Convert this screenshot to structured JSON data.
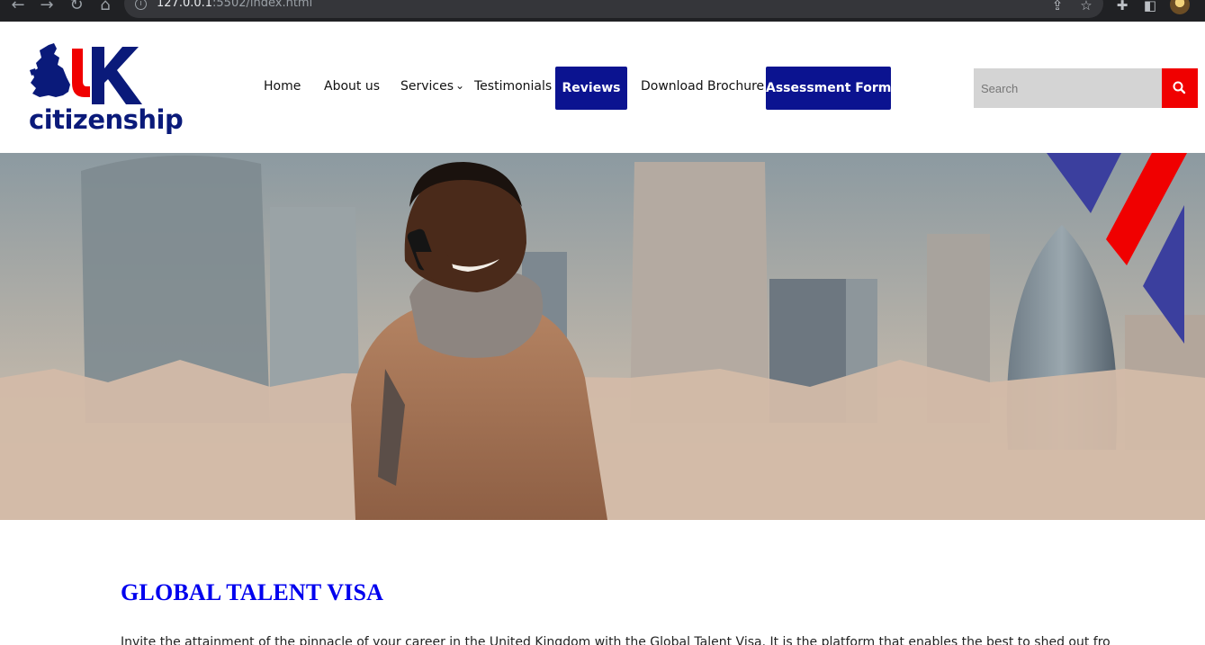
{
  "browser": {
    "url_host": "127.0.0.1",
    "url_rest": ":5502/index.html",
    "icons": [
      "back-arrow-icon",
      "forward-arrow-icon",
      "reload-icon",
      "home-icon",
      "site-info-icon",
      "share-icon",
      "star-icon",
      "extensions-icon",
      "sidepanel-icon",
      "profile-avatar"
    ]
  },
  "logo": {
    "uk_letters": "UK",
    "wordmark": "citizenship",
    "colors": {
      "navy": "#0a1a7a",
      "red": "#f00000"
    }
  },
  "nav": {
    "home": "Home",
    "about": "About us",
    "services": "Services",
    "testimonials": "Testimonials",
    "reviews": "Reviews",
    "brochure": "Download Brochure",
    "assessment": "Assessment Form",
    "pill_color": "#0b1390"
  },
  "search": {
    "placeholder": "Search",
    "button_icon": "search-icon",
    "button_color": "#f00000"
  },
  "hero": {
    "image": "man-on-phone-london-skyline",
    "accent_colors": [
      "#3b3f9e",
      "#f00000"
    ]
  },
  "content": {
    "title": "GLOBAL TALENT VISA",
    "title_color": "#0000ee",
    "intro": "Invite the attainment of the pinnacle of your career in the United Kingdom with the Global Talent Visa. It is the platform that enables the best to shed out from around"
  }
}
